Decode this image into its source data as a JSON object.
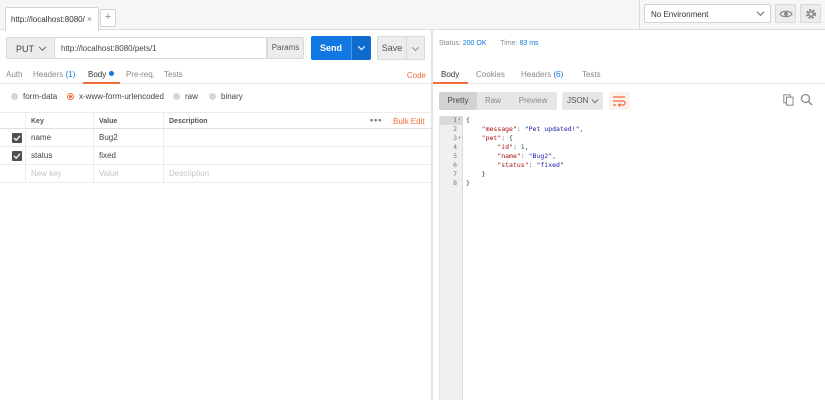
{
  "tabs": [
    {
      "label": "http://localhost:8080/",
      "close": "×"
    }
  ],
  "new_tab_label": "+",
  "environment": {
    "selected": "No Environment"
  },
  "request": {
    "method": "PUT",
    "url": "http://localhost:8080/pets/1",
    "params_label": "Params",
    "send_label": "Send",
    "save_label": "Save"
  },
  "request_tabs": {
    "auth": "Auth",
    "headers": "Headers",
    "headers_count": "(1)",
    "body": "Body",
    "prereq": "Pre-req.",
    "tests": "Tests",
    "code": "Code"
  },
  "body_modes": [
    "form-data",
    "x-www-form-urlencoded",
    "raw",
    "binary"
  ],
  "body_mode_selected": "x-www-form-urlencoded",
  "kv_table": {
    "headers": [
      "Key",
      "Value",
      "Description"
    ],
    "more": "•••",
    "bulk_edit": "Bulk Edit",
    "rows": [
      {
        "key": "name",
        "value": "Bug2",
        "description": "",
        "checked": true
      },
      {
        "key": "status",
        "value": "fixed",
        "description": "",
        "checked": true
      }
    ],
    "placeholders": {
      "key": "New key",
      "value": "Value",
      "description": "Description"
    }
  },
  "response": {
    "status_label": "Status:",
    "status_value": "200 OK",
    "time_label": "Time:",
    "time_value": "83 ms",
    "tabs": {
      "body": "Body",
      "cookies": "Cookies",
      "headers": "Headers",
      "headers_count": "(6)",
      "tests": "Tests"
    },
    "views": [
      "Pretty",
      "Raw",
      "Preview"
    ],
    "view_selected": "Pretty",
    "format": "JSON",
    "code_lines": [
      "{",
      "    \"message\": \"Pet updated!\",",
      "    \"pet\": {",
      "        \"id\": 1,",
      "        \"name\": \"Bug2\",",
      "        \"status\": \"fixed\"",
      "    }",
      "}"
    ]
  },
  "icons": {
    "env_dropdown": "chevron-down-icon",
    "env_view": "eye-icon",
    "settings": "gear-icon",
    "send_dropdown": "chevron-down-icon",
    "save_dropdown": "chevron-down-icon",
    "wrap": "wrap-lines-icon",
    "copy": "copy-icon",
    "search": "search-icon"
  },
  "colors": {
    "accent": "#f26b3a",
    "primary": "#1078e0",
    "status_ok": "#1078e0"
  }
}
